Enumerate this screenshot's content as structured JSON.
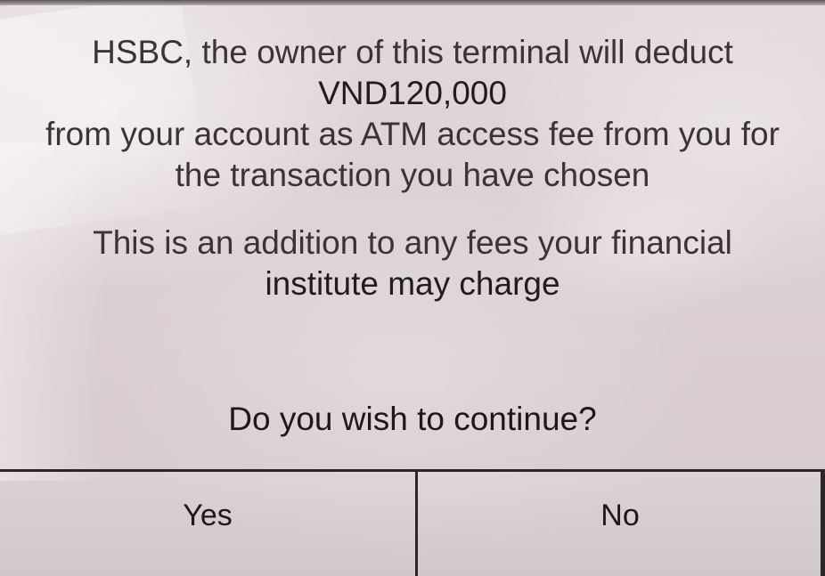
{
  "dialog": {
    "fee_notice": [
      "HSBC, the owner of this terminal will deduct",
      "VND120,000",
      "from your account as ATM access fee from you for",
      "the transaction you have chosen"
    ],
    "additional_notice": [
      "This is an addition to any fees your financial",
      "institute may charge"
    ],
    "question": "Do you wish to continue?"
  },
  "buttons": {
    "yes_label": "Yes",
    "no_label": "No"
  },
  "colors": {
    "screen_background": "#ddd2d6",
    "text": "#1e1a1d",
    "divider": "#2b2629"
  }
}
